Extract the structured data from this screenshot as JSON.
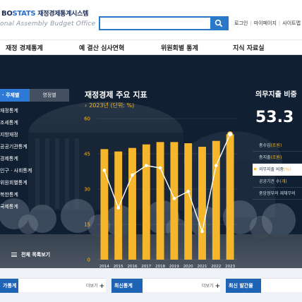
{
  "header": {
    "logo_bo": "BO",
    "logo_stats": "STATS",
    "logo_kr": "재정경제통계시스템",
    "logo_sub": "onal Assembly Budget Office",
    "search_placeholder": "",
    "util_links": [
      "로그인",
      "마이페이지",
      "사이트맵"
    ]
  },
  "gnb": [
    "재정 경제통계",
    "예 결산 심사연혁",
    "위원회별 통계",
    "지식 자료실"
  ],
  "side": {
    "tab_theme": "· 주제별",
    "tab_area": "영정별",
    "items": [
      "재정통계",
      "조세통계",
      "지방재정",
      "공공기관통계",
      "경제통계",
      "인구 · 사회통계",
      "위원회별통계",
      "복한통계",
      "국제통계"
    ],
    "all_menu": "전체 목록보기"
  },
  "chart": {
    "title": "재정경제 주요 지표",
    "subtitle": "2023년 (단위: %)"
  },
  "chart_data": {
    "type": "bar",
    "categories": [
      "2014",
      "2015",
      "2016",
      "2017",
      "2018",
      "2019",
      "2020",
      "2021",
      "2022",
      "2023"
    ],
    "series": [
      {
        "values": [
          47,
          46,
          47.5,
          49,
          50,
          50,
          49.5,
          48,
          50.5,
          53.3
        ]
      },
      {
        "values": [
          38,
          22,
          36,
          40,
          39,
          26,
          29,
          12,
          40,
          53.3
        ]
      }
    ],
    "ylim": [
      0,
      60
    ],
    "yticks": [
      0,
      15,
      30,
      45,
      60
    ],
    "bar_color": "#f5b62c",
    "line_color": "#ffffff"
  },
  "right_panel": {
    "title": "의무지출 비중",
    "value": "53.3",
    "items": [
      {
        "label": "총수입",
        "unit": "(조원)"
      },
      {
        "label": "총지출",
        "unit": "(조원)"
      },
      {
        "label": "의무지출 비중",
        "unit": "(%)"
      },
      {
        "label": "공공기관 수",
        "unit": "(개)"
      },
      {
        "label": "중앙정부의 재채무비",
        "unit": ""
      }
    ],
    "active_index": 2
  },
  "bottom": {
    "box1_title": "가통계",
    "box2_title": "최신통계",
    "box3_title": "최신 발간물",
    "more_label": "더보기"
  }
}
